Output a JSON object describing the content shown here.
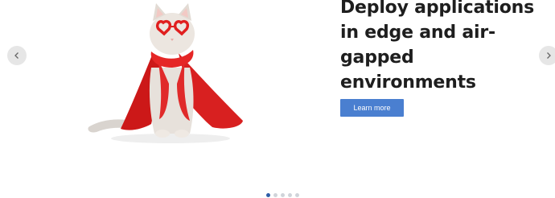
{
  "carousel": {
    "headline": "Deploy applications in edge and air-gapped environments",
    "cta_label": "Learn more",
    "image_icon": "cat-in-red-cape-and-heart-glasses",
    "prev_icon": "chevron-left-icon",
    "next_icon": "chevron-right-icon",
    "slides_total": 5,
    "active_slide": 1,
    "colors": {
      "cta": "#4a7fd0",
      "active_dot": "#2f5ea8",
      "inactive_dot": "#d0d4da"
    }
  }
}
